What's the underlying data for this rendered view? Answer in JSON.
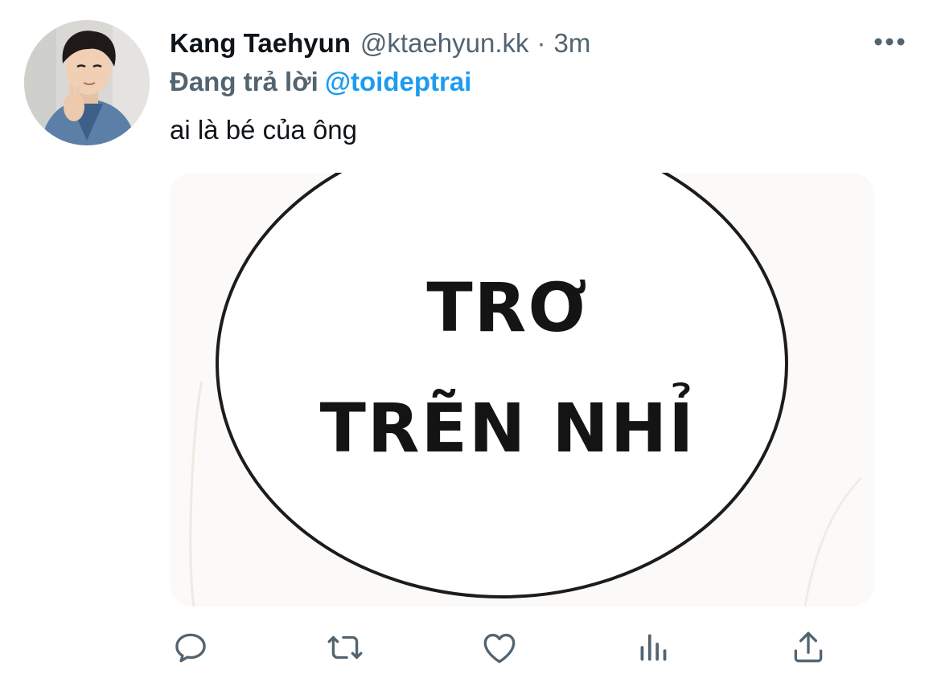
{
  "tweet": {
    "author": {
      "display_name": "Kang Taehyun",
      "handle": "@ktaehyun.kk"
    },
    "separator": "·",
    "timestamp": "3m",
    "reply": {
      "prefix": "Đang trả lời",
      "mention": "@toideptrai"
    },
    "text": "ai là bé của ông",
    "media": {
      "lines": [
        "TRƠ",
        "TRẼN NHỈ"
      ]
    }
  },
  "actions": [
    {
      "name": "reply",
      "icon": "comment-icon"
    },
    {
      "name": "retweet",
      "icon": "retweet-icon"
    },
    {
      "name": "like",
      "icon": "heart-icon"
    },
    {
      "name": "analytics",
      "icon": "bar-chart-icon"
    },
    {
      "name": "share",
      "icon": "share-icon"
    }
  ],
  "colors": {
    "text": "#0f1419",
    "secondary": "#536471",
    "accent": "#1d9bf0",
    "icon": "#536471"
  }
}
